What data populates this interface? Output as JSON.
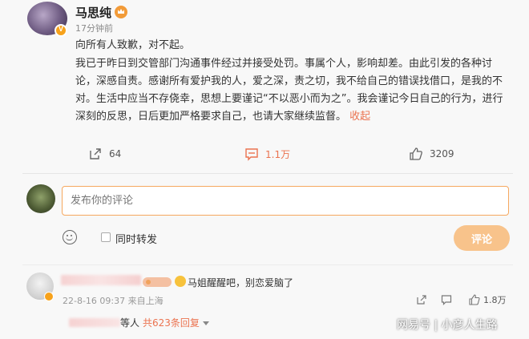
{
  "post": {
    "author": "马思纯",
    "time": "17分钟前",
    "paragraph1": "向所有人致歉，对不起。",
    "paragraph2": "我已于昨日到交管部门沟通事件经过并接受处罚。事属个人，影响却差。由此引发的各种讨论，深感自责。感谢所有爱护我的人，爱之深，责之切，我不给自己的错误找借口，是我的不对。生活中应当不存侥幸，思想上要谨记“不以恶小而为之”。我会谨记今日自己的行为，进行深刻的反思，日后更加严格要求自己，也请大家继续监督。",
    "collapse": "收起"
  },
  "actions": {
    "repost_count": "64",
    "comment_count": "1.1万",
    "like_count": "3209"
  },
  "composer": {
    "placeholder": "发布你的评论",
    "repost_label": "同时转发",
    "submit_label": "评论"
  },
  "comment": {
    "text": "马姐醒醒吧，别恋爱脑了",
    "meta": "22-8-16 09:37 来自上海",
    "like_count": "1.8万",
    "replies_suffix": "等人",
    "replies_link": "共623条回复"
  },
  "watermark": "网易号 | 小彦人生路",
  "colors": {
    "accent": "#eb7350",
    "input_border": "#f6a85f",
    "button_bg": "#f8c38b"
  }
}
